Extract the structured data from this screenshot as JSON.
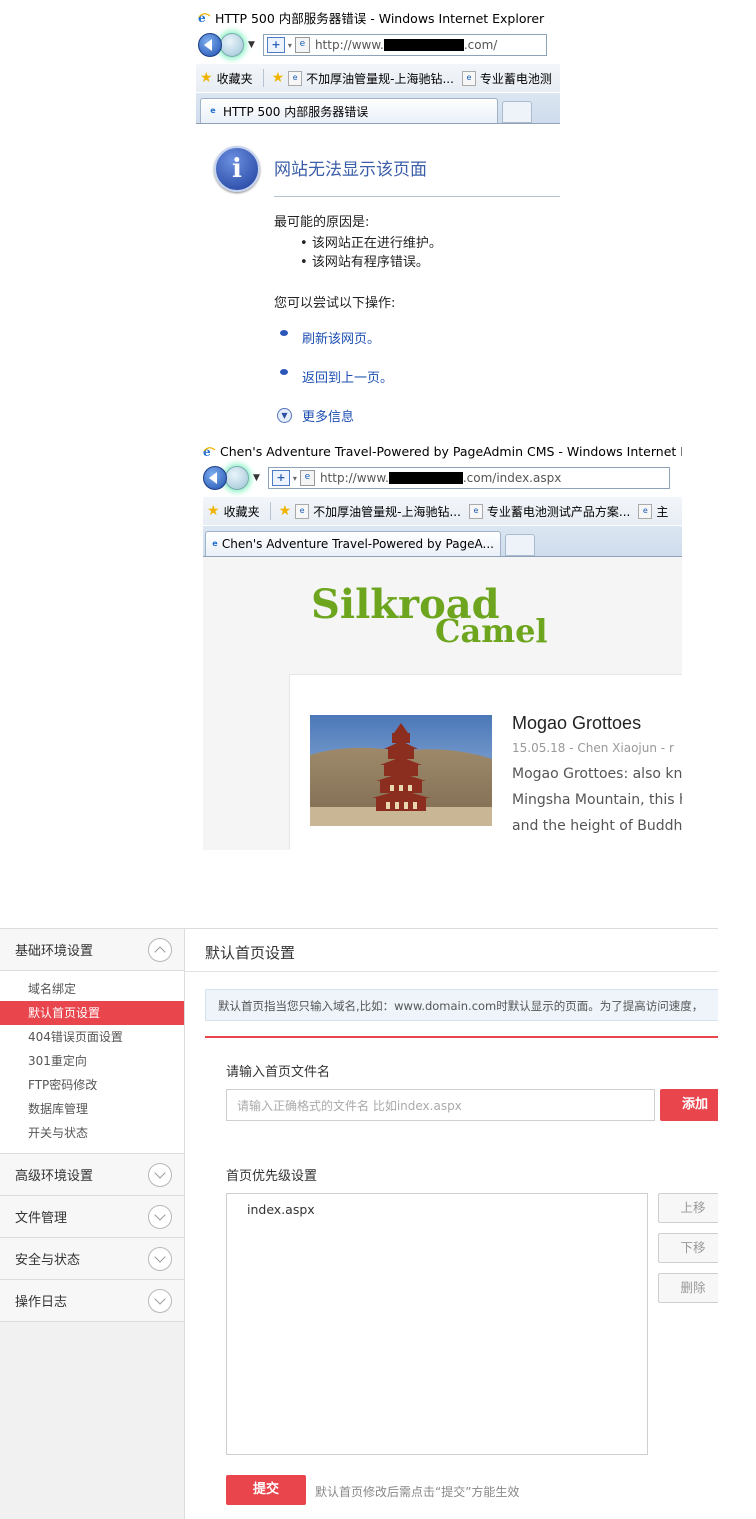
{
  "window1": {
    "title": "HTTP 500 内部服务器错误 - Windows Internet Explorer",
    "url_prefix": "http://www.",
    "url_suffix": ".com/",
    "favorites_label": "收藏夹",
    "fav_items": [
      "不加厚油管量规-上海驰钻...",
      "专业蓄电池测"
    ],
    "tab_label": "HTTP 500 内部服务器错误"
  },
  "error_page": {
    "heading": "网站无法显示该页面",
    "reason_title": "最可能的原因是:",
    "reasons": [
      "该网站正在进行维护。",
      "该网站有程序错误。"
    ],
    "try_title": "您可以尝试以下操作:",
    "actions": [
      "刷新该网页。",
      "返回到上一页。"
    ],
    "more_info": "更多信息"
  },
  "window2": {
    "title": "Chen's Adventure Travel-Powered by PageAdmin CMS - Windows Internet Explo",
    "url_prefix": "http://www.",
    "url_suffix": ".com/index.aspx",
    "favorites_label": "收藏夹",
    "fav_items": [
      "不加厚油管量规-上海驰钻...",
      "专业蓄电池测试产品方案...",
      "主"
    ],
    "tab_label": "Chen's Adventure Travel-Powered by PageA..."
  },
  "site": {
    "logo_line1": "Silkroad",
    "logo_line2": "Camel",
    "post": {
      "title": "Mogao Grottoes",
      "meta": "15.05.18  -  Chen Xiaojun  -  r",
      "lines": [
        "Mogao Grottoes: also kno",
        "Mingsha Mountain, this ho",
        "and the height of Buddhis"
      ]
    }
  },
  "admin": {
    "sidebar": {
      "sections": [
        {
          "label": "基础环境设置",
          "expanded": true,
          "items": [
            "域名绑定",
            "默认首页设置",
            "404错误页面设置",
            "301重定向",
            "FTP密码修改",
            "数据库管理",
            "开关与状态"
          ],
          "active_index": 1
        },
        {
          "label": "高级环境设置",
          "expanded": false
        },
        {
          "label": "文件管理",
          "expanded": false
        },
        {
          "label": "安全与状态",
          "expanded": false
        },
        {
          "label": "操作日志",
          "expanded": false
        }
      ]
    },
    "main": {
      "title": "默认首页设置",
      "tip": "默认首页指当您只输入域名,比如：www.domain.com时默认显示的页面。为了提高访问速度，",
      "input_label": "请输入首页文件名",
      "input_placeholder": "请输入正确格式的文件名   比如index.aspx",
      "add_button": "添加",
      "priority_label": "首页优先级设置",
      "priority_list": [
        "index.aspx"
      ],
      "move_up": "上移",
      "move_down": "下移",
      "delete": "删除",
      "submit": "提交",
      "submit_hint": "默认首页修改后需点击“提交”方能生效"
    },
    "accent_color": "#e8454d"
  }
}
